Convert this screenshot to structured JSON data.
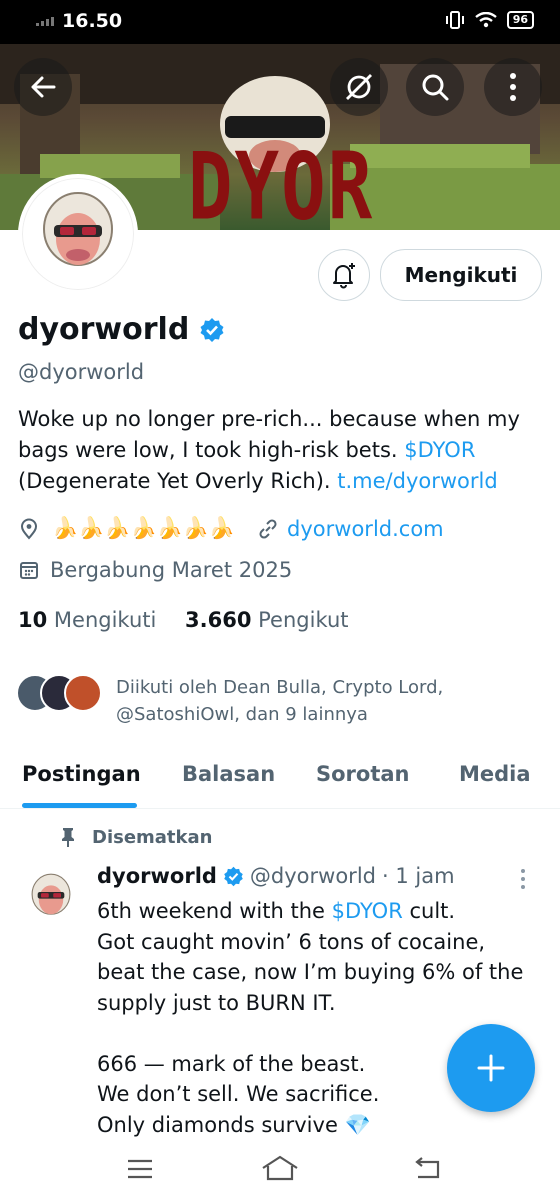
{
  "status_bar": {
    "time": "16.50",
    "battery": "96"
  },
  "banner": {
    "text": "DYOR"
  },
  "actions": {
    "follow_label": "Mengikuti"
  },
  "profile": {
    "name": "dyorworld",
    "handle": "@dyorworld",
    "bio_text": "Woke up no longer pre-rich... because when my bags were low, I took high-risk bets. ",
    "bio_tag": "$DYOR",
    "bio_text2": " (Degenerate Yet Overly Rich). ",
    "bio_link": "t.me/dyorworld",
    "location": "🍌🍌🍌🍌🍌🍌🍌",
    "website": "dyorworld.com",
    "joined": "Bergabung Maret 2025",
    "following_count": "10",
    "following_label": "Mengikuti",
    "followers_count": "3.660",
    "followers_label": "Pengikut",
    "followed_by": "Diikuti oleh Dean Bulla, Crypto Lord,",
    "followed_by2": "@SatoshiOwl, dan 9 lainnya"
  },
  "tabs": [
    {
      "label": "Postingan"
    },
    {
      "label": "Balasan"
    },
    {
      "label": "Sorotan"
    },
    {
      "label": "Media"
    }
  ],
  "pinned_post": {
    "pinned_label": "Disematkan",
    "author": "dyorworld",
    "handle": "@dyorworld",
    "time": "· 1 jam",
    "line1_pre": "6th weekend with the ",
    "line1_tag": "$DYOR",
    "line1_post": " cult.",
    "body": "Got caught movin’ 6 tons of cocaine, beat the case, now I’m buying 6% of the supply just to BURN IT.\n\n666 — mark of the beast.\nWe don’t sell. We sacrifice.\nOnly diamonds survive 💎"
  },
  "colors": {
    "accent": "#1d9bf0",
    "text": "#0f1419",
    "muted": "#536471"
  }
}
